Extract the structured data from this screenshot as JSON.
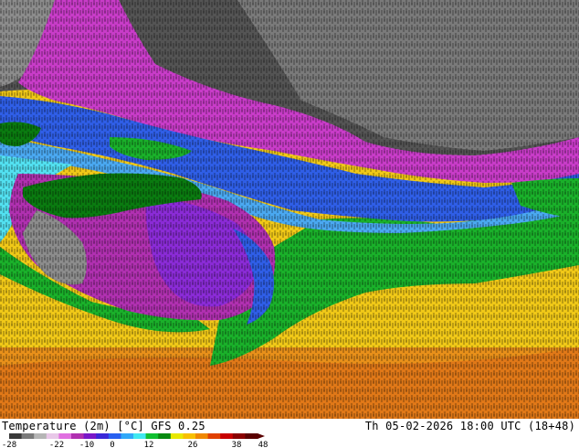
{
  "footer": {
    "title": "Temperature (2m) [°C] GFS 0.25",
    "datetime": "Th 05-02-2026 18:00 UTC (18+48)"
  },
  "legend": {
    "ticks": [
      "-28",
      "-22",
      "-10",
      "0",
      "12",
      "26",
      "38",
      "48"
    ],
    "colors": [
      "#3a3a3a",
      "#7a7a7a",
      "#b5b5b5",
      "#e8c8e8",
      "#e070e0",
      "#b030b0",
      "#7a18c8",
      "#3a28d8",
      "#2860f0",
      "#30a8f8",
      "#40e8f0",
      "#10c030",
      "#088a10",
      "#e8e800",
      "#f8c000",
      "#f08800",
      "#e04000",
      "#c80000",
      "#8a0000",
      "#5a0000"
    ]
  },
  "map": {
    "colors": {
      "dark_gray": "#545454",
      "mid_gray": "#8c8c8c",
      "magenta": "#c83cc8",
      "violet": "#8a2bd6",
      "blue": "#2f5ee6",
      "light_blue": "#4aa8f0",
      "cyan": "#52e0f0",
      "green": "#1ab02a",
      "dark_green": "#0a7a10",
      "yellow": "#f0c818",
      "orange": "#e8901a"
    }
  }
}
